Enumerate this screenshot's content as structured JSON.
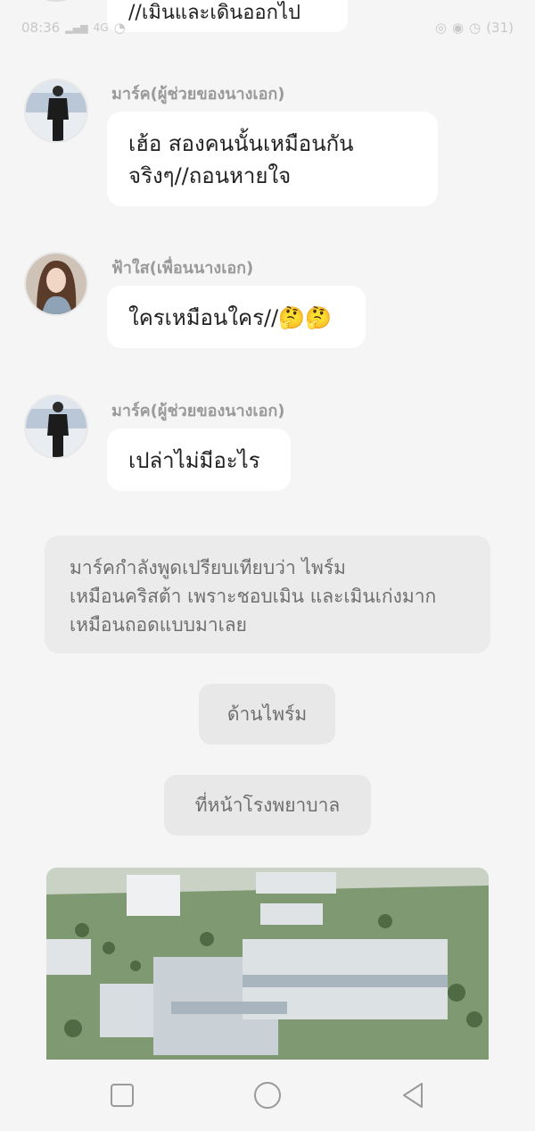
{
  "status_bar": {
    "time": "08:36",
    "network": "4G",
    "battery": "(31)"
  },
  "clipped_message": {
    "text": "//เมินและเดินออกไป"
  },
  "messages": [
    {
      "sender": "มาร์ค(ผู้ช่วยของนางเอก)",
      "lines": [
        "เฮ้อ สองคนนั้นเหมือนกัน",
        "จริงๆ//ถอนหายใจ"
      ]
    },
    {
      "sender": "ฟ้าใส(เพื่อนนางเอก)",
      "lines": [
        "ใครเหมือนใคร//🤔🤔"
      ]
    },
    {
      "sender": "มาร์ค(ผู้ช่วยของนางเอก)",
      "lines": [
        "เปล่าไม่มีอะไร"
      ]
    }
  ],
  "narration": {
    "lines": [
      "มาร์คกำลังพูดเปรียบเทียบว่า ไพร์ม",
      "เหมือนคริสต้า เพราะชอบเมิน และเมินเก่งมาก",
      "เหมือนถอดแบบมาเลย"
    ]
  },
  "tags": {
    "side": "ด้านไพร์ม",
    "location": "ที่หน้าโรงพยาบาล"
  },
  "colors": {
    "background": "#f5f5f5",
    "bubble": "#ffffff",
    "narration_bg": "#ebebeb",
    "sender": "#9a9a9a"
  }
}
